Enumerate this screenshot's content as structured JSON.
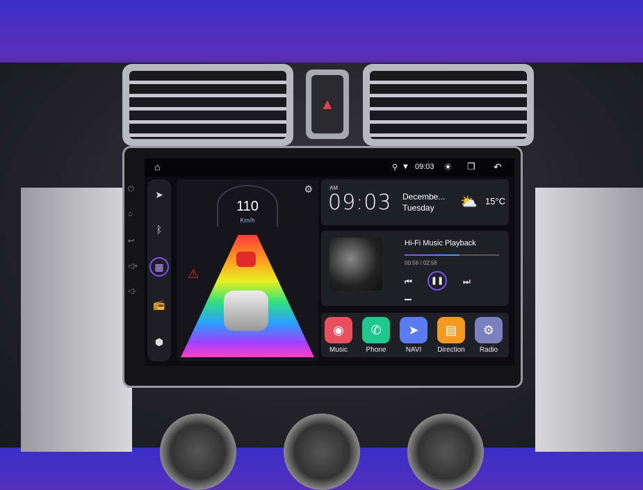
{
  "status_bar": {
    "time": "09:03",
    "icons": [
      "home-icon",
      "location-icon",
      "wifi-icon",
      "brightness-icon",
      "recent-apps-icon",
      "back-icon"
    ]
  },
  "sidebar": {
    "items": [
      "navigation-icon",
      "bluetooth-icon",
      "apps-icon",
      "radio-icon",
      "settings-icon"
    ],
    "active": "apps-icon"
  },
  "hardware_buttons": [
    "power-icon",
    "home-icon",
    "back-icon",
    "volume-up-icon",
    "volume-down-icon"
  ],
  "speedometer": {
    "speed": "110",
    "unit": "Km/h"
  },
  "clock": {
    "ampm": "AM",
    "time": "09:03",
    "date": "Decembe...",
    "weekday": "Tuesday",
    "temperature": "15°C",
    "weather_icon": "partly-cloudy-icon"
  },
  "music": {
    "title": "Hi-Fi Music Playback",
    "elapsed": "00:58",
    "total": "02:56",
    "separator": " / ",
    "progress": 0.58,
    "accent": "#8a4dff"
  },
  "apps": [
    {
      "label": "Music",
      "color": "#e85060",
      "icon": "record-icon"
    },
    {
      "label": "Phone",
      "color": "#20c890",
      "icon": "phone-icon"
    },
    {
      "label": "NAVI",
      "color": "#5a7cf0",
      "icon": "navigation-icon"
    },
    {
      "label": "Direction",
      "color": "#f59a20",
      "icon": "folder-icon"
    },
    {
      "label": "Radio",
      "color": "#7a80c0",
      "icon": "radio-icon"
    }
  ]
}
